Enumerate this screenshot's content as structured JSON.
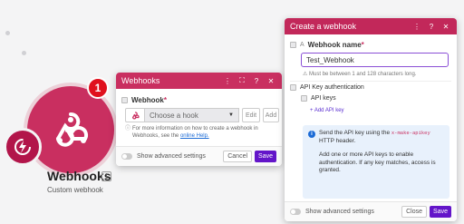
{
  "module": {
    "badge_count": "1",
    "title": "Webhooks",
    "id": "1",
    "subtitle": "Custom webhook"
  },
  "hook_panel": {
    "title": "Webhooks",
    "field_label": "Webhook",
    "select_placeholder": "Choose a hook",
    "edit_label": "Edit",
    "add_label": "Add",
    "info_text": "For more information on how to create a webhook in Webhooks, see the",
    "info_link": "online Help.",
    "toggle_label": "Show advanced settings",
    "cancel_label": "Cancel",
    "save_label": "Save"
  },
  "create_panel": {
    "title": "Create a webhook",
    "name_label": "Webhook name",
    "name_value": "Test_Webhook",
    "name_hint": "Must be between 1 and 128 characters long.",
    "auth_label": "API Key authentication",
    "keys_label": "API keys",
    "add_key_label": "+ Add API key",
    "note_p1_a": "Send the API key using the",
    "note_p1_code": "x-make-apikey",
    "note_p1_b": "HTTP header.",
    "note_p2": "Add one or more API keys to enable authentication. If any key matches, access is granted.",
    "toggle_label": "Show advanced settings",
    "close_label": "Close",
    "save_label": "Save"
  },
  "colors": {
    "brand": "#c92f60",
    "primary_button": "#6315c9",
    "badge": "#e0111e"
  }
}
